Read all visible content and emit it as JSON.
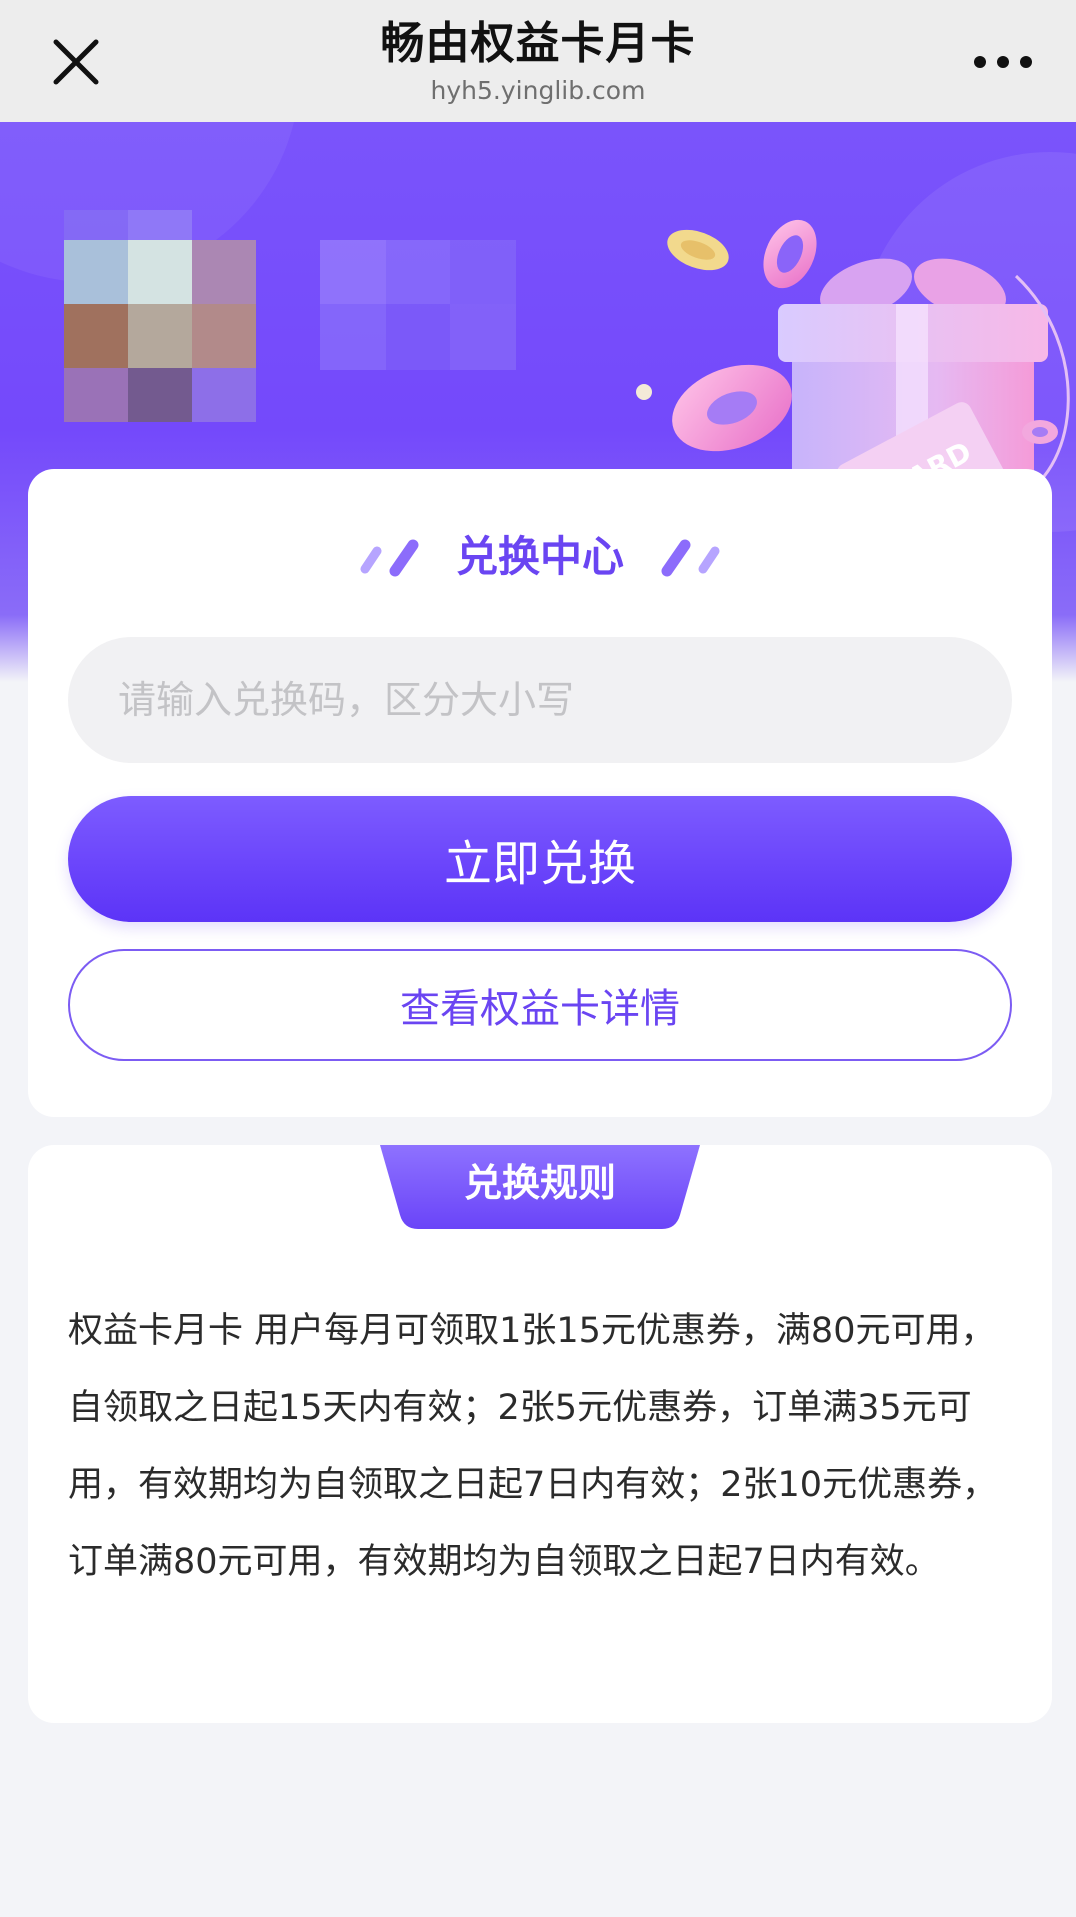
{
  "navbar": {
    "title": "畅由权益卡月卡",
    "url": "hyh5.yinglib.com",
    "close_icon": "close-icon",
    "more_icon": "more-icon"
  },
  "hero": {
    "card_badge_text": "CARD",
    "colors": {
      "primary": "#7449fb",
      "accent": "#6a45f2"
    }
  },
  "redeem": {
    "section_title": "兑换中心",
    "input_placeholder": "请输入兑换码，区分大小写",
    "input_value": "",
    "redeem_button": "立即兑换",
    "details_button": "查看权益卡详情"
  },
  "rules": {
    "title": "兑换规则",
    "text": "权益卡月卡 用户每月可领取1张15元优惠券，满80元可用，自领取之日起15天内有效；2张5元优惠券，订单满35元可用，有效期均为自领取之日起7日内有效；2张10元优惠券，订单满80元可用，有效期均为自领取之日起7日内有效。"
  }
}
